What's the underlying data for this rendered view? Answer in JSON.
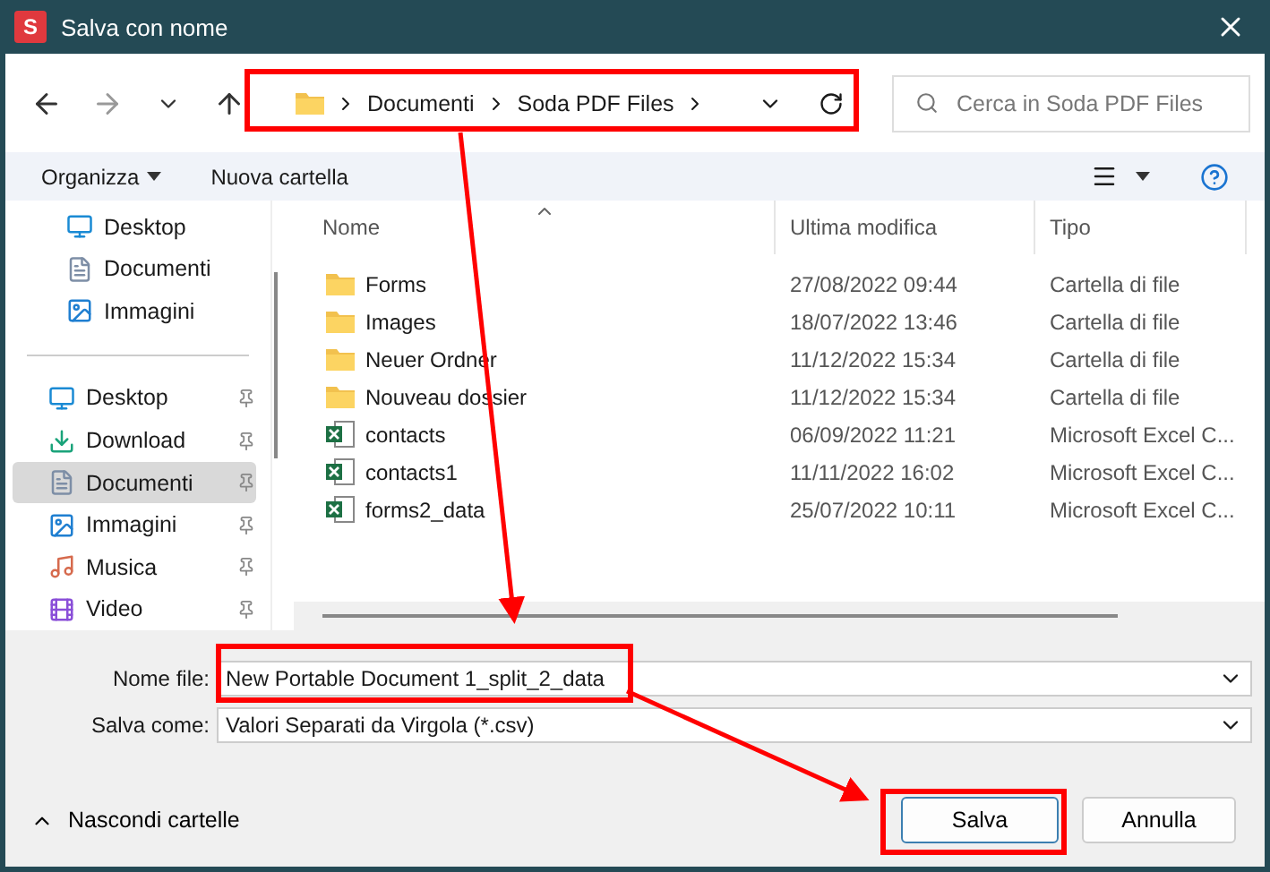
{
  "window": {
    "title": "Salva con nome",
    "app_icon": "S"
  },
  "nav": {
    "path": [
      "Documenti",
      "Soda PDF Files"
    ],
    "search": {
      "placeholder": "Cerca in Soda PDF Files"
    }
  },
  "toolbar": {
    "organize": "Organizza",
    "new_folder": "Nuova cartella"
  },
  "sidebar": {
    "quick": [
      {
        "label": "Desktop",
        "kind": "desktop"
      },
      {
        "label": "Documenti",
        "kind": "documents"
      },
      {
        "label": "Immagini",
        "kind": "pictures"
      }
    ],
    "pinned": [
      {
        "label": "Desktop",
        "kind": "desktop",
        "selected": false
      },
      {
        "label": "Download",
        "kind": "download",
        "selected": false
      },
      {
        "label": "Documenti",
        "kind": "documents",
        "selected": true
      },
      {
        "label": "Immagini",
        "kind": "pictures",
        "selected": false
      },
      {
        "label": "Musica",
        "kind": "music",
        "selected": false
      },
      {
        "label": "Video",
        "kind": "video",
        "selected": false
      }
    ]
  },
  "table": {
    "columns": [
      "Nome",
      "Ultima modifica",
      "Tipo"
    ],
    "rows": [
      {
        "name": "Forms",
        "kind": "folder",
        "modified": "27/08/2022 09:44",
        "type": "Cartella di file"
      },
      {
        "name": "Images",
        "kind": "folder",
        "modified": "18/07/2022 13:46",
        "type": "Cartella di file"
      },
      {
        "name": "Neuer Ordner",
        "kind": "folder",
        "modified": "11/12/2022 15:34",
        "type": "Cartella di file"
      },
      {
        "name": "Nouveau dossier",
        "kind": "folder",
        "modified": "11/12/2022 15:34",
        "type": "Cartella di file"
      },
      {
        "name": "contacts",
        "kind": "excel",
        "modified": "06/09/2022 11:21",
        "type": "Microsoft Excel C..."
      },
      {
        "name": "contacts1",
        "kind": "excel",
        "modified": "11/11/2022 16:02",
        "type": "Microsoft Excel C..."
      },
      {
        "name": "forms2_data",
        "kind": "excel",
        "modified": "25/07/2022 10:11",
        "type": "Microsoft Excel C..."
      }
    ]
  },
  "form": {
    "filename_label": "Nome file:",
    "filename": "New Portable Document 1_split_2_data",
    "type_label": "Salva come:",
    "type": "Valori Separati da Virgola (*.csv)"
  },
  "footer": {
    "hide_folders": "Nascondi cartelle",
    "save": "Salva",
    "cancel": "Annulla"
  }
}
